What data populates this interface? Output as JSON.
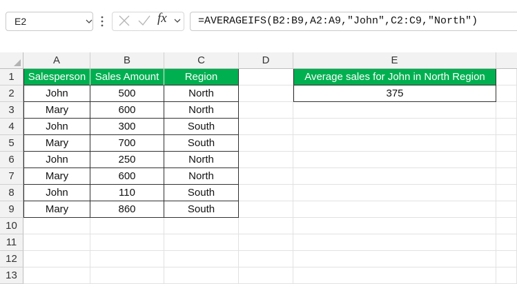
{
  "formula_bar": {
    "name_box": "E2",
    "formula": "=AVERAGEIFS(B2:B9,A2:A9,\"John\",C2:C9,\"North\")",
    "fx_label": "fx"
  },
  "sheet": {
    "columns": [
      "A",
      "B",
      "C",
      "D",
      "E"
    ],
    "rows": [
      "1",
      "2",
      "3",
      "4",
      "5",
      "6",
      "7",
      "8",
      "9",
      "10",
      "11",
      "12",
      "13"
    ],
    "table": {
      "headers": [
        "Salesperson",
        "Sales Amount",
        "Region"
      ],
      "rows": [
        [
          "John",
          "500",
          "North"
        ],
        [
          "Mary",
          "600",
          "North"
        ],
        [
          "John",
          "300",
          "South"
        ],
        [
          "Mary",
          "700",
          "South"
        ],
        [
          "John",
          "250",
          "North"
        ],
        [
          "Mary",
          "600",
          "North"
        ],
        [
          "John",
          "110",
          "South"
        ],
        [
          "Mary",
          "860",
          "South"
        ]
      ]
    },
    "result": {
      "header": "Average sales for John in North Region",
      "value": "375"
    }
  },
  "colors": {
    "header_fill": "#00b050",
    "header_text": "#ffffff",
    "border": "#2f2f2f"
  }
}
